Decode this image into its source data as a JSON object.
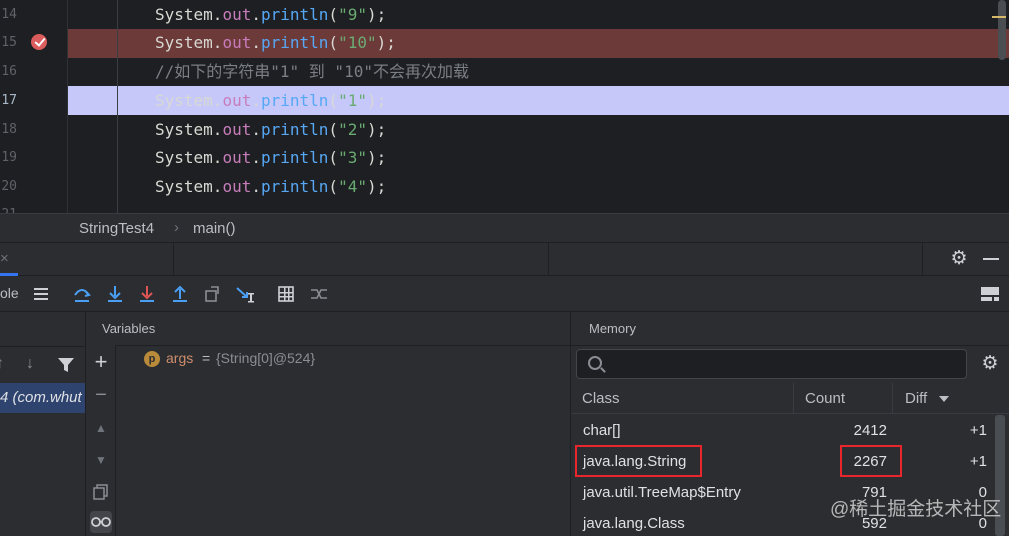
{
  "editor": {
    "lines": [
      {
        "num": "14",
        "parts": [
          [
            "sys",
            "System."
          ],
          [
            "out",
            "out"
          ],
          [
            "sys",
            "."
          ],
          [
            "fn",
            "println"
          ],
          [
            "sys",
            "("
          ],
          [
            "str",
            "\"9\""
          ],
          [
            "sys",
            ");"
          ]
        ]
      },
      {
        "num": "15",
        "parts": [
          [
            "sys",
            "System."
          ],
          [
            "out",
            "out"
          ],
          [
            "sys",
            "."
          ],
          [
            "fn",
            "println"
          ],
          [
            "sys",
            "("
          ],
          [
            "str",
            "\"10\""
          ],
          [
            "sys",
            ");"
          ]
        ]
      },
      {
        "num": "16",
        "comment": "//如下的字符串\"1\" 到 \"10\"不会再次加载"
      },
      {
        "num": "17",
        "parts": [
          [
            "sys",
            "System."
          ],
          [
            "out",
            "out"
          ],
          [
            "sys",
            "."
          ],
          [
            "fn",
            "println"
          ],
          [
            "sys",
            "("
          ],
          [
            "str",
            "\"1\""
          ],
          [
            "sys",
            ");"
          ]
        ]
      },
      {
        "num": "18",
        "parts": [
          [
            "sys",
            "System."
          ],
          [
            "out",
            "out"
          ],
          [
            "sys",
            "."
          ],
          [
            "fn",
            "println"
          ],
          [
            "sys",
            "("
          ],
          [
            "str",
            "\"2\""
          ],
          [
            "sys",
            ");"
          ]
        ]
      },
      {
        "num": "19",
        "parts": [
          [
            "sys",
            "System."
          ],
          [
            "out",
            "out"
          ],
          [
            "sys",
            "."
          ],
          [
            "fn",
            "println"
          ],
          [
            "sys",
            "("
          ],
          [
            "str",
            "\"3\""
          ],
          [
            "sys",
            ");"
          ]
        ]
      },
      {
        "num": "20",
        "parts": [
          [
            "sys",
            "System."
          ],
          [
            "out",
            "out"
          ],
          [
            "sys",
            "."
          ],
          [
            "fn",
            "println"
          ],
          [
            "sys",
            "("
          ],
          [
            "str",
            "\"4\""
          ],
          [
            "sys",
            ");"
          ]
        ]
      }
    ]
  },
  "breadcrumb": {
    "file": "StringTest4",
    "separator": "›",
    "method": "main()"
  },
  "debug_header": {
    "close_glyph": "×"
  },
  "toolbar": {
    "console_tab_partial": "ole"
  },
  "frames": {
    "selected_frame_partial": "4 (com.whut"
  },
  "variables": {
    "title": "Variables",
    "items": [
      {
        "badge": "p",
        "name": "args",
        "eq": "=",
        "value": "{String[0]@524}"
      }
    ]
  },
  "memory": {
    "title": "Memory",
    "search_placeholder": "",
    "headers": {
      "class": "Class",
      "count": "Count",
      "diff": "Diff"
    },
    "rows": [
      {
        "class": "char[]",
        "count": "2412",
        "diff": "+1"
      },
      {
        "class": "java.lang.String",
        "count": "2267",
        "diff": "+1"
      },
      {
        "class": "java.util.TreeMap$Entry",
        "count": "791",
        "diff": "0"
      },
      {
        "class": "java.lang.Class",
        "count": "592",
        "diff": "0"
      }
    ]
  },
  "watermark": "@稀土掘金技术社区",
  "colors": {
    "breakpoint_line": "#6d3a3a",
    "execution_line": "#c6c8fa",
    "highlight_box": "#e8262b",
    "accent": "#3574f0"
  }
}
